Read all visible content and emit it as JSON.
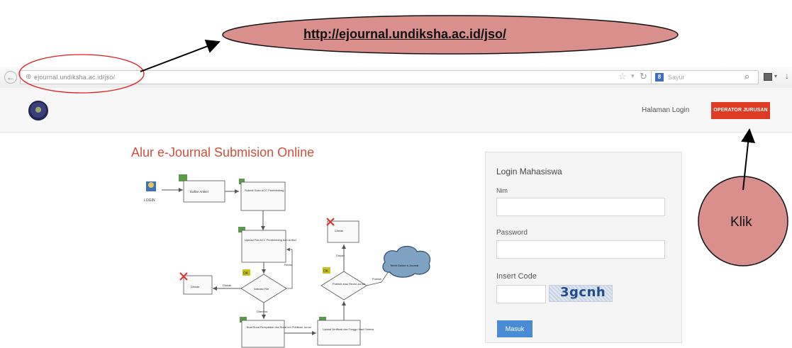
{
  "annotations": {
    "url_callout": "http://ejournal.undiksha.ac.id/jso/",
    "click_callout": "Klik",
    "callout_fill": "#d98f8b",
    "ring_color": "#e51b1b"
  },
  "browser": {
    "url": "ejournal.undiksha.ac.id/jso/",
    "search_engine": "Google",
    "search_placeholder": "Sayur",
    "icons": [
      "back-icon",
      "site-icon",
      "star-icon",
      "reload-icon",
      "search-icon",
      "library-icon",
      "download-icon"
    ]
  },
  "site": {
    "nav_login": "Halaman Login",
    "operator_button": "OPERATOR JURUSAN",
    "accent_color": "#dd3b23"
  },
  "flow": {
    "title": "Alur e-Journal Submision Online",
    "nodes": {
      "login": "LOGIN",
      "daftar": "Daftar Artikel",
      "submit_scan": "Submit Scan ACC Pembimbing",
      "upload": "Upload File ACC Pembimbing dan Artikel",
      "valid_check": "Validasi File",
      "revisi": "Revisi",
      "buatsurat": "Buat Surat Pernyataan dan Surat Izin Publikasi Jurnal",
      "upload_verif": "Upload Verifikasi dan Tunggu Hasil Seleksi",
      "publish_check": "Publish atau Revisi Jurnal",
      "ditolak": "Ditolak",
      "terbit": "Terbit Online e-Journal"
    },
    "edges": {
      "e_revisi": "Revisi",
      "e_valid": "Valid",
      "e_diterima": "Diterima",
      "e_ditolak": "Ditolak",
      "e_publish": "Publish"
    },
    "badges": {
      "ok": "OK"
    }
  },
  "login_form": {
    "title": "Login Mahasiswa",
    "nim_label": "Nim",
    "password_label": "Password",
    "code_label": "Insert Code",
    "captcha": "3gcnh",
    "submit_label": "Masuk"
  }
}
